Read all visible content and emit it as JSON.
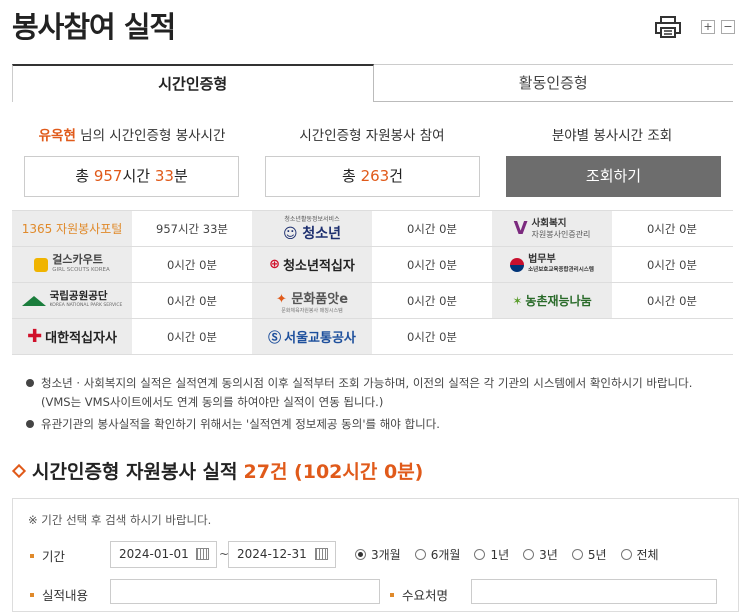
{
  "page": {
    "title": "봉사참여 실적",
    "zoom_in": "+",
    "zoom_out": "−"
  },
  "tabs": [
    {
      "label": "시간인증형",
      "active": true
    },
    {
      "label": "활동인증형",
      "active": false
    }
  ],
  "summary": {
    "user_name": "유옥현",
    "col1_suffix": " 님의 시간인증형 봉사시간",
    "col2_label": "시간인증형 자원봉사 참여",
    "col3_label": "분야별 봉사시간 조회",
    "total_prefix": "총 ",
    "total_hours": "957",
    "hours_unit": "시간 ",
    "total_minutes": "33",
    "minutes_unit": "분",
    "count_prefix": "총 ",
    "count_value": "263",
    "count_unit": "건",
    "lookup_button": "조회하기"
  },
  "orgs": [
    {
      "logo_text": "1365 자원봉사포털",
      "value": "957시간 33분"
    },
    {
      "logo_text": "청소년",
      "logo_sub": "청소년활동정보서비스",
      "value": "0시간 0분"
    },
    {
      "logo_text": "사회복지",
      "logo_sub": "자원봉사인증관리",
      "value": "0시간 0분"
    },
    {
      "logo_text": "걸스카우트",
      "logo_sub": "GIRL SCOUTS KOREA",
      "value": "0시간 0분"
    },
    {
      "logo_text": "청소년적십자",
      "value": "0시간 0분"
    },
    {
      "logo_text": "법무부",
      "logo_sub": "소년보호교육종합관리시스템",
      "value": "0시간 0분"
    },
    {
      "logo_text": "국립공원공단",
      "logo_sub": "KOREA NATIONAL PARK SERVICE",
      "value": "0시간 0분"
    },
    {
      "logo_text": "문화품앗e",
      "logo_sub": "문화체육자원봉사 매칭시스템",
      "value": "0시간 0분"
    },
    {
      "logo_text": "농촌재능나눔",
      "value": "0시간 0분"
    },
    {
      "logo_text": "대한적십자사",
      "value": "0시간 0분"
    },
    {
      "logo_text": "서울교통공사",
      "value": "0시간 0분"
    }
  ],
  "notes": {
    "line1": "청소년 · 사회복지의 실적은 실적연계 동의시점 이후 실적부터 조회 가능하며, 이전의 실적은 각 기관의 시스템에서 확인하시기 바랍니다.",
    "line1b": "(VMS는 VMS사이트에서도 연계 동의를 하여야만 실적이 연동 됩니다.)",
    "line2": "유관기관의 봉사실적을 확인하기 위해서는 '실적연계 정보제공 동의'를 해야 합니다."
  },
  "section": {
    "title": "시간인증형 자원봉사 실적",
    "stat": "27건 (102시간 0분)"
  },
  "search": {
    "hint": "※ 기간 선택 후 검색 하시기 바랍니다.",
    "period_label": "기간",
    "date_from": "2024-01-01",
    "date_sep": "~",
    "date_to": "2024-12-31",
    "radios": [
      {
        "label": "3개월",
        "checked": true
      },
      {
        "label": "6개월",
        "checked": false
      },
      {
        "label": "1년",
        "checked": false
      },
      {
        "label": "3년",
        "checked": false
      },
      {
        "label": "5년",
        "checked": false
      },
      {
        "label": "전체",
        "checked": false
      }
    ],
    "content_label": "실적내용",
    "content_value": "",
    "org_label": "수요처명",
    "org_value": ""
  },
  "colors": {
    "accent": "#e05a1a",
    "button_dark": "#6d6d6d",
    "logo_bg": "#ececec"
  }
}
